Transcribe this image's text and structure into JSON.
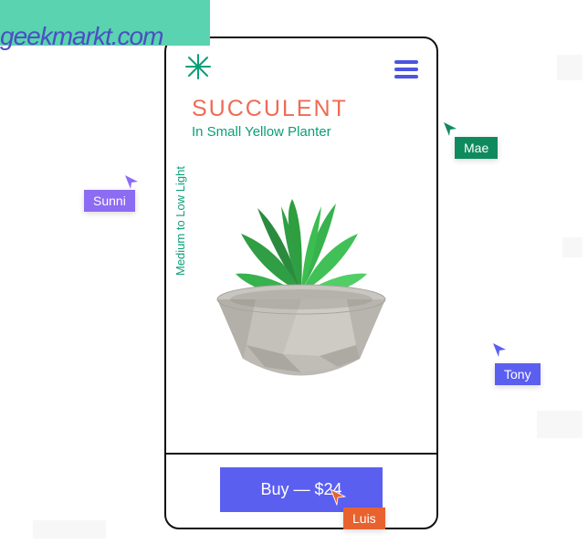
{
  "watermark": "geekmarkt.com",
  "product": {
    "title": "SUCCULENT",
    "subtitle": "In Small Yellow Planter",
    "side_note": "Medium to Low Light"
  },
  "buy": {
    "label": "Buy — $24",
    "price": 24
  },
  "cursors": {
    "sunni": {
      "name": "Sunni",
      "color": "#8c6cf2"
    },
    "mae": {
      "name": "Mae",
      "color": "#0f8a5f"
    },
    "tony": {
      "name": "Tony",
      "color": "#5b5ff0"
    },
    "luis": {
      "name": "Luis",
      "color": "#e8622f"
    }
  }
}
